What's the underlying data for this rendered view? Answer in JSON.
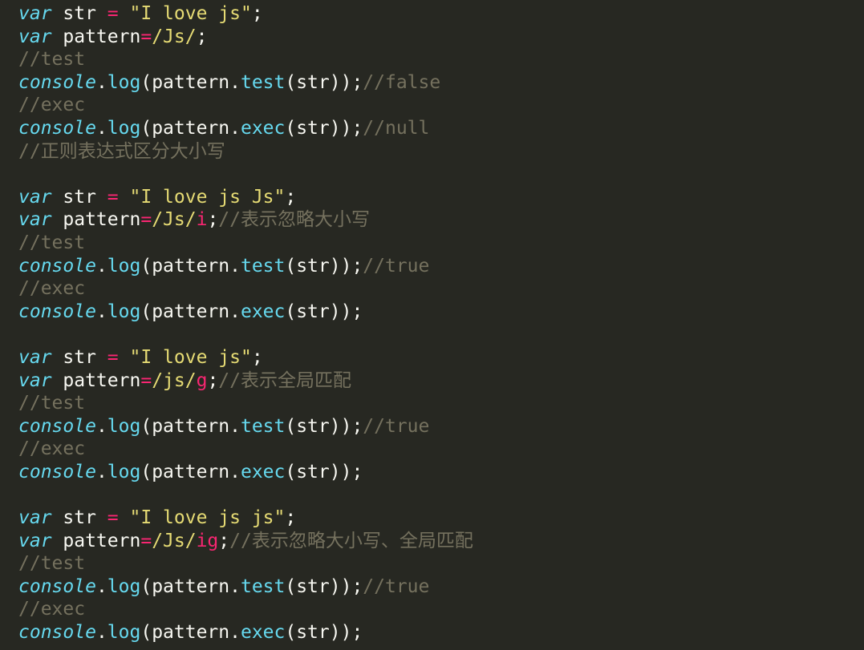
{
  "colors": {
    "background": "#272822",
    "keyword": "#66d9ef",
    "console": "#66d9ef",
    "method": "#66d9ef",
    "operator": "#f92672",
    "regex": "#e6db74",
    "regex_flag": "#f92672",
    "string": "#e6db74",
    "comment": "#75715e",
    "plain": "#f8f8f2"
  },
  "code_lines": [
    [
      {
        "t": "var",
        "c": "keyword",
        "i": true
      },
      {
        "t": " str ",
        "c": "plain"
      },
      {
        "t": "=",
        "c": "operator"
      },
      {
        "t": " ",
        "c": "plain"
      },
      {
        "t": "\"I love js\"",
        "c": "string"
      },
      {
        "t": ";",
        "c": "plain"
      }
    ],
    [
      {
        "t": "var",
        "c": "keyword",
        "i": true
      },
      {
        "t": " pattern",
        "c": "plain"
      },
      {
        "t": "=",
        "c": "operator"
      },
      {
        "t": "/Js/",
        "c": "regex"
      },
      {
        "t": ";",
        "c": "plain"
      }
    ],
    [
      {
        "t": "//test",
        "c": "comment"
      }
    ],
    [
      {
        "t": "console",
        "c": "console",
        "i": true
      },
      {
        "t": ".",
        "c": "plain"
      },
      {
        "t": "log",
        "c": "method"
      },
      {
        "t": "(pattern.",
        "c": "plain"
      },
      {
        "t": "test",
        "c": "method"
      },
      {
        "t": "(str));",
        "c": "plain"
      },
      {
        "t": "//false",
        "c": "comment"
      }
    ],
    [
      {
        "t": "//exec",
        "c": "comment"
      }
    ],
    [
      {
        "t": "console",
        "c": "console",
        "i": true
      },
      {
        "t": ".",
        "c": "plain"
      },
      {
        "t": "log",
        "c": "method"
      },
      {
        "t": "(pattern.",
        "c": "plain"
      },
      {
        "t": "exec",
        "c": "method"
      },
      {
        "t": "(str));",
        "c": "plain"
      },
      {
        "t": "//null",
        "c": "comment"
      }
    ],
    [
      {
        "t": "//正则表达式区分大小写",
        "c": "comment"
      }
    ],
    [],
    [
      {
        "t": "var",
        "c": "keyword",
        "i": true
      },
      {
        "t": " str ",
        "c": "plain"
      },
      {
        "t": "=",
        "c": "operator"
      },
      {
        "t": " ",
        "c": "plain"
      },
      {
        "t": "\"I love js Js\"",
        "c": "string"
      },
      {
        "t": ";",
        "c": "plain"
      }
    ],
    [
      {
        "t": "var",
        "c": "keyword",
        "i": true
      },
      {
        "t": " pattern",
        "c": "plain"
      },
      {
        "t": "=",
        "c": "operator"
      },
      {
        "t": "/Js/",
        "c": "regex"
      },
      {
        "t": "i",
        "c": "regex_flag"
      },
      {
        "t": ";",
        "c": "plain"
      },
      {
        "t": "//表示忽略大小写",
        "c": "comment"
      }
    ],
    [
      {
        "t": "//test",
        "c": "comment"
      }
    ],
    [
      {
        "t": "console",
        "c": "console",
        "i": true
      },
      {
        "t": ".",
        "c": "plain"
      },
      {
        "t": "log",
        "c": "method"
      },
      {
        "t": "(pattern.",
        "c": "plain"
      },
      {
        "t": "test",
        "c": "method"
      },
      {
        "t": "(str));",
        "c": "plain"
      },
      {
        "t": "//true",
        "c": "comment"
      }
    ],
    [
      {
        "t": "//exec",
        "c": "comment"
      }
    ],
    [
      {
        "t": "console",
        "c": "console",
        "i": true
      },
      {
        "t": ".",
        "c": "plain"
      },
      {
        "t": "log",
        "c": "method"
      },
      {
        "t": "(pattern.",
        "c": "plain"
      },
      {
        "t": "exec",
        "c": "method"
      },
      {
        "t": "(str));",
        "c": "plain"
      }
    ],
    [],
    [
      {
        "t": "var",
        "c": "keyword",
        "i": true
      },
      {
        "t": " str ",
        "c": "plain"
      },
      {
        "t": "=",
        "c": "operator"
      },
      {
        "t": " ",
        "c": "plain"
      },
      {
        "t": "\"I love js\"",
        "c": "string"
      },
      {
        "t": ";",
        "c": "plain"
      }
    ],
    [
      {
        "t": "var",
        "c": "keyword",
        "i": true
      },
      {
        "t": " pattern",
        "c": "plain"
      },
      {
        "t": "=",
        "c": "operator"
      },
      {
        "t": "/js/",
        "c": "regex"
      },
      {
        "t": "g",
        "c": "regex_flag"
      },
      {
        "t": ";",
        "c": "plain"
      },
      {
        "t": "//表示全局匹配",
        "c": "comment"
      }
    ],
    [
      {
        "t": "//test",
        "c": "comment"
      }
    ],
    [
      {
        "t": "console",
        "c": "console",
        "i": true
      },
      {
        "t": ".",
        "c": "plain"
      },
      {
        "t": "log",
        "c": "method"
      },
      {
        "t": "(pattern.",
        "c": "plain"
      },
      {
        "t": "test",
        "c": "method"
      },
      {
        "t": "(str));",
        "c": "plain"
      },
      {
        "t": "//true",
        "c": "comment"
      }
    ],
    [
      {
        "t": "//exec",
        "c": "comment"
      }
    ],
    [
      {
        "t": "console",
        "c": "console",
        "i": true
      },
      {
        "t": ".",
        "c": "plain"
      },
      {
        "t": "log",
        "c": "method"
      },
      {
        "t": "(pattern.",
        "c": "plain"
      },
      {
        "t": "exec",
        "c": "method"
      },
      {
        "t": "(str));",
        "c": "plain"
      }
    ],
    [],
    [
      {
        "t": "var",
        "c": "keyword",
        "i": true
      },
      {
        "t": " str ",
        "c": "plain"
      },
      {
        "t": "=",
        "c": "operator"
      },
      {
        "t": " ",
        "c": "plain"
      },
      {
        "t": "\"I love js js\"",
        "c": "string"
      },
      {
        "t": ";",
        "c": "plain"
      }
    ],
    [
      {
        "t": "var",
        "c": "keyword",
        "i": true
      },
      {
        "t": " pattern",
        "c": "plain"
      },
      {
        "t": "=",
        "c": "operator"
      },
      {
        "t": "/Js/",
        "c": "regex"
      },
      {
        "t": "ig",
        "c": "regex_flag"
      },
      {
        "t": ";",
        "c": "plain"
      },
      {
        "t": "//表示忽略大小写、全局匹配",
        "c": "comment"
      }
    ],
    [
      {
        "t": "//test",
        "c": "comment"
      }
    ],
    [
      {
        "t": "console",
        "c": "console",
        "i": true
      },
      {
        "t": ".",
        "c": "plain"
      },
      {
        "t": "log",
        "c": "method"
      },
      {
        "t": "(pattern.",
        "c": "plain"
      },
      {
        "t": "test",
        "c": "method"
      },
      {
        "t": "(str));",
        "c": "plain"
      },
      {
        "t": "//true",
        "c": "comment"
      }
    ],
    [
      {
        "t": "//exec",
        "c": "comment"
      }
    ],
    [
      {
        "t": "console",
        "c": "console",
        "i": true
      },
      {
        "t": ".",
        "c": "plain"
      },
      {
        "t": "log",
        "c": "method"
      },
      {
        "t": "(pattern.",
        "c": "plain"
      },
      {
        "t": "exec",
        "c": "method"
      },
      {
        "t": "(str));",
        "c": "plain"
      }
    ]
  ]
}
